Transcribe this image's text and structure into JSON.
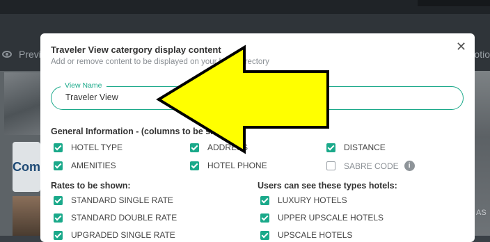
{
  "toolbar": {
    "preview_label": "Previ",
    "options_label": "otio"
  },
  "background": {
    "card_text": "Com",
    "side_text": "AS"
  },
  "modal": {
    "title": "Traveler View catergory display content",
    "subtitle": "Add or remove content to be displayed on your hotel directory",
    "close_symbol": "✕",
    "view_name": {
      "label": "View Name",
      "value": "Traveler View"
    },
    "general": {
      "heading": "General Information - (columns to be shown)",
      "options": [
        {
          "label": "HOTEL TYPE",
          "checked": true
        },
        {
          "label": "ADDRESS",
          "checked": true
        },
        {
          "label": "DISTANCE",
          "checked": true
        },
        {
          "label": "AMENITIES",
          "checked": true
        },
        {
          "label": "HOTEL PHONE",
          "checked": true
        },
        {
          "label": "SABRE CODE",
          "checked": false
        }
      ]
    },
    "rates": {
      "heading": "Rates to be shown:",
      "options": [
        {
          "label": "STANDARD SINGLE RATE",
          "checked": true
        },
        {
          "label": "STANDARD DOUBLE RATE",
          "checked": true
        },
        {
          "label": "UPGRADED SINGLE RATE",
          "checked": true
        }
      ]
    },
    "hotel_types": {
      "heading": "Users can see these types hotels:",
      "options": [
        {
          "label": "LUXURY HOTELS",
          "checked": true
        },
        {
          "label": "UPPER UPSCALE HOTELS",
          "checked": true
        },
        {
          "label": "UPSCALE HOTELS",
          "checked": true
        }
      ]
    }
  },
  "colors": {
    "accent": "#1aa98a",
    "arrow_fill": "#ffff00",
    "arrow_stroke": "#000000"
  }
}
